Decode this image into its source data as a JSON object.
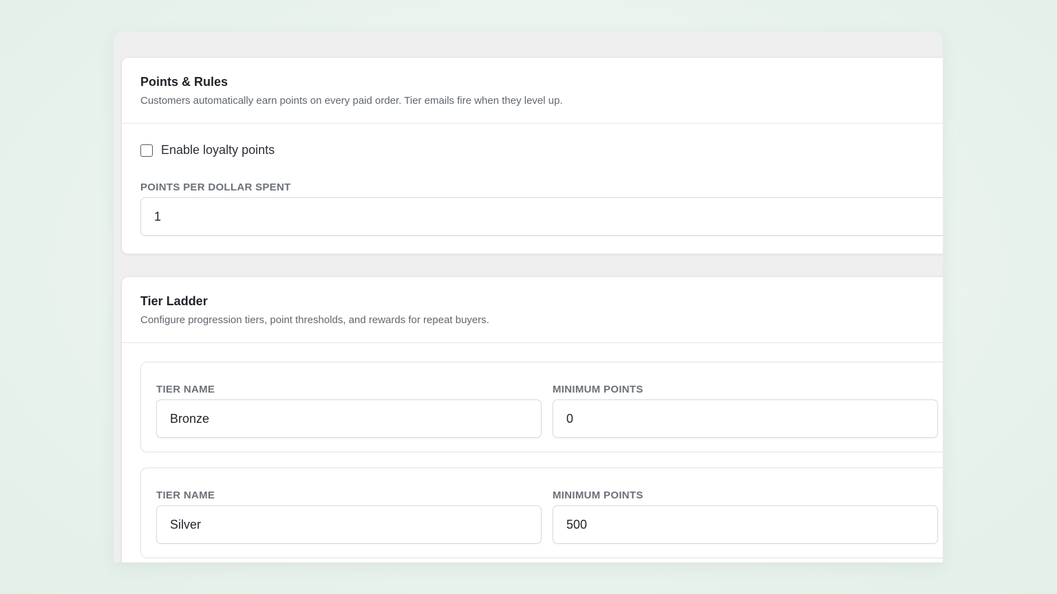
{
  "points_rules": {
    "title": "Points & Rules",
    "description": "Customers automatically earn points on every paid order. Tier emails fire when they level up.",
    "enable_label": "Enable loyalty points",
    "enabled": false,
    "points_per_dollar_label": "POINTS PER DOLLAR SPENT",
    "points_per_dollar_value": "1"
  },
  "tier_ladder": {
    "title": "Tier Ladder",
    "description": "Configure progression tiers, point thresholds, and rewards for repeat buyers.",
    "tiers": [
      {
        "name_label": "TIER NAME",
        "name_value": "Bronze",
        "min_label": "MINIMUM POINTS",
        "min_value": "0"
      },
      {
        "name_label": "TIER NAME",
        "name_value": "Silver",
        "min_label": "MINIMUM POINTS",
        "min_value": "500"
      }
    ]
  }
}
